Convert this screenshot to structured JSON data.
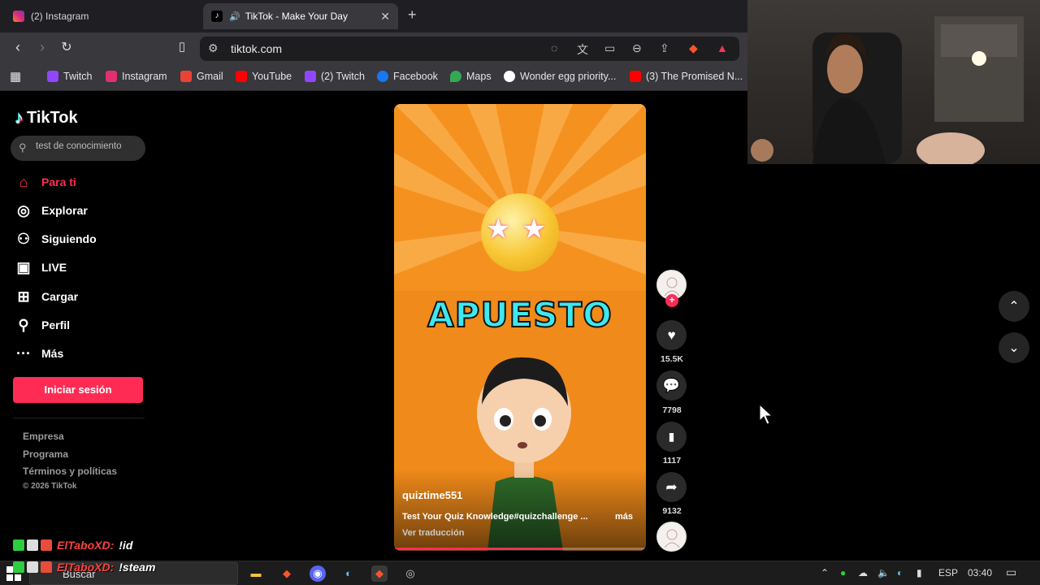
{
  "browser": {
    "tabs": [
      {
        "title": "(2) Instagram"
      },
      {
        "title": "TikTok - Make Your Day"
      }
    ],
    "url": "tiktok.com",
    "bookmarks": [
      {
        "label": "Twitch",
        "color": "#9146ff"
      },
      {
        "label": "Instagram",
        "color": "#e1306c"
      },
      {
        "label": "Gmail",
        "color": "#ea4335"
      },
      {
        "label": "YouTube",
        "color": "#ff0000"
      },
      {
        "label": "(2) Twitch",
        "color": "#9146ff"
      },
      {
        "label": "Facebook",
        "color": "#1877f2"
      },
      {
        "label": "Maps",
        "color": "#34a853"
      },
      {
        "label": "Wonder egg priority...",
        "color": "#ffffff"
      },
      {
        "label": "(3) The Promised N...",
        "color": "#ff0000"
      }
    ]
  },
  "tiktok": {
    "logo": "TikTok",
    "search": {
      "placeholder": "test de conocimiento"
    },
    "nav": [
      {
        "label": "Para ti",
        "icon": "home-icon"
      },
      {
        "label": "Explorar",
        "icon": "compass-icon"
      },
      {
        "label": "Siguiendo",
        "icon": "following-icon"
      },
      {
        "label": "LIVE",
        "icon": "live-icon"
      },
      {
        "label": "Cargar",
        "icon": "upload-icon"
      },
      {
        "label": "Perfil",
        "icon": "profile-icon"
      },
      {
        "label": "Más",
        "icon": "more-icon"
      }
    ],
    "login": "Iniciar sesión",
    "footer": [
      "Empresa",
      "Programa",
      "Términos y políticas"
    ],
    "copyright": "© 2026 TikTok",
    "video": {
      "overlay_text": "APUESTO",
      "username": "quiztime551",
      "caption": "Test Your Quiz Knowledge#quizchallenge ...",
      "more": "más",
      "translate": "Ver traducción",
      "progress": 0.67
    },
    "actions": {
      "likes": "15.5K",
      "comments": "7798",
      "saves": "1117",
      "shares": "9132"
    }
  },
  "chat": [
    {
      "user": "ElTaboXD:",
      "message": "!id"
    },
    {
      "user": "ElTaboXD:",
      "message": "!steam"
    }
  ],
  "taskbar": {
    "search": "Buscar",
    "lang": "ESP",
    "time": "03:40"
  }
}
